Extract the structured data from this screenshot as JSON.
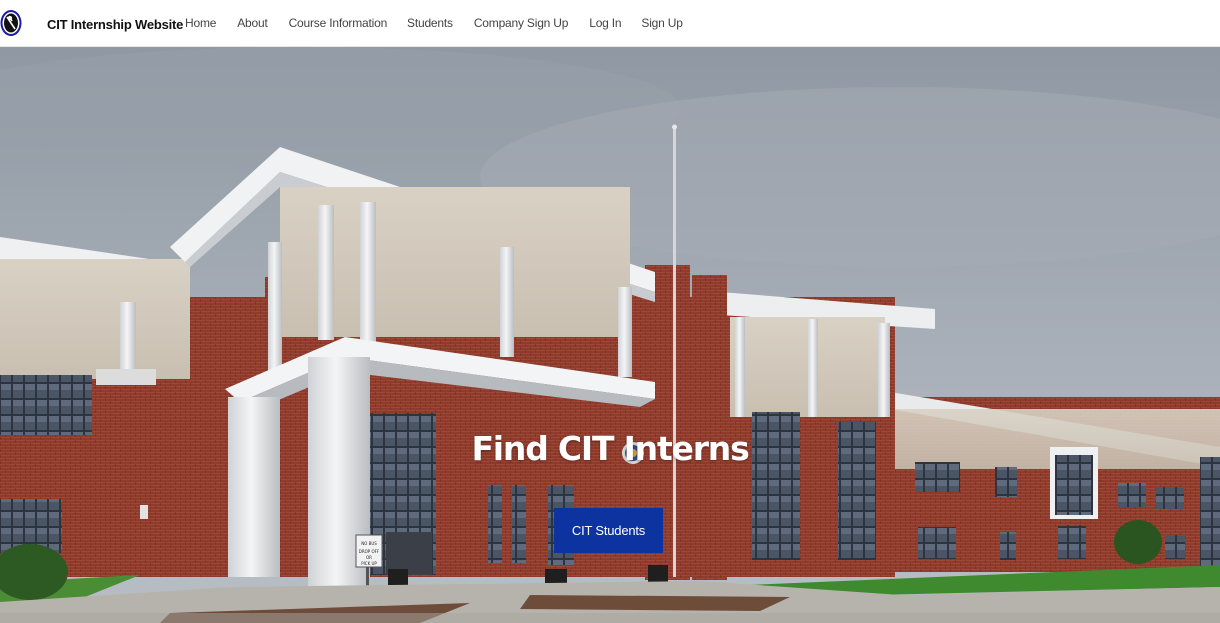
{
  "navbar": {
    "brand": "CIT Internship Website",
    "links": [
      {
        "label": "Home"
      },
      {
        "label": "About"
      },
      {
        "label": "Course Information"
      },
      {
        "label": "Students"
      },
      {
        "label": "Company Sign Up"
      },
      {
        "label": "Log In"
      },
      {
        "label": "Sign Up"
      }
    ]
  },
  "hero": {
    "title": "Find CIT Interns",
    "button_label": "CIT Students",
    "sign_text": "NO BUS DROP OFF OR PICK UP"
  },
  "colors": {
    "button": "#0d33a0",
    "sky": "#9aa2ad",
    "brick": "#8f3a2b",
    "lawn": "#3f8a2e"
  },
  "icons": {
    "logo": "cit-logo-icon"
  }
}
